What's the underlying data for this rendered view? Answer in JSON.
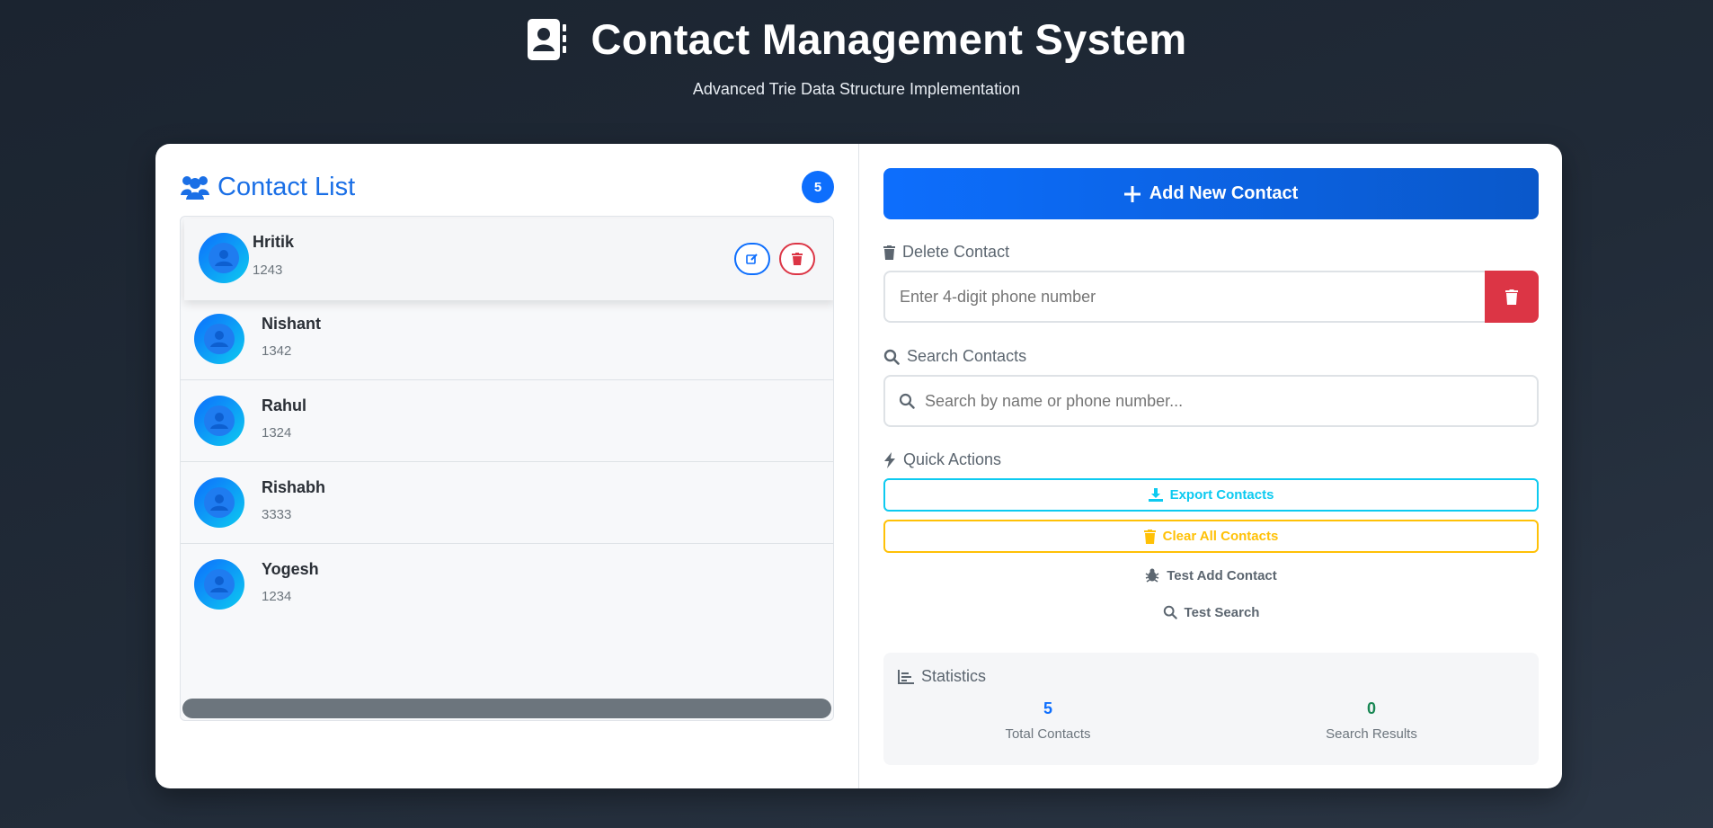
{
  "header": {
    "title": "Contact Management System",
    "subtitle": "Advanced Trie Data Structure Implementation",
    "icon": "contact-book-icon"
  },
  "contact_list": {
    "title": "Contact List",
    "count": "5",
    "contacts": [
      {
        "name": "Hritik",
        "phone": "1243"
      },
      {
        "name": "Nishant",
        "phone": "1342"
      },
      {
        "name": "Rahul",
        "phone": "1324"
      },
      {
        "name": "Rishabh",
        "phone": "3333"
      },
      {
        "name": "Yogesh",
        "phone": "1234"
      }
    ]
  },
  "actions": {
    "add_label": "Add New Contact",
    "delete_section": "Delete Contact",
    "delete_placeholder": "Enter 4-digit phone number",
    "search_section": "Search Contacts",
    "search_placeholder": "Search by name or phone number...",
    "quick_actions": "Quick Actions",
    "export_label": "Export Contacts",
    "clear_label": "Clear All Contacts",
    "test_add_label": "Test Add Contact",
    "test_search_label": "Test Search"
  },
  "statistics": {
    "title": "Statistics",
    "total_value": "5",
    "total_label": "Total Contacts",
    "results_value": "0",
    "results_label": "Search Results"
  },
  "colors": {
    "primary": "#0d6efd",
    "danger": "#dc3545",
    "info": "#0dcaf0",
    "warning": "#ffc107",
    "success": "#198754"
  }
}
